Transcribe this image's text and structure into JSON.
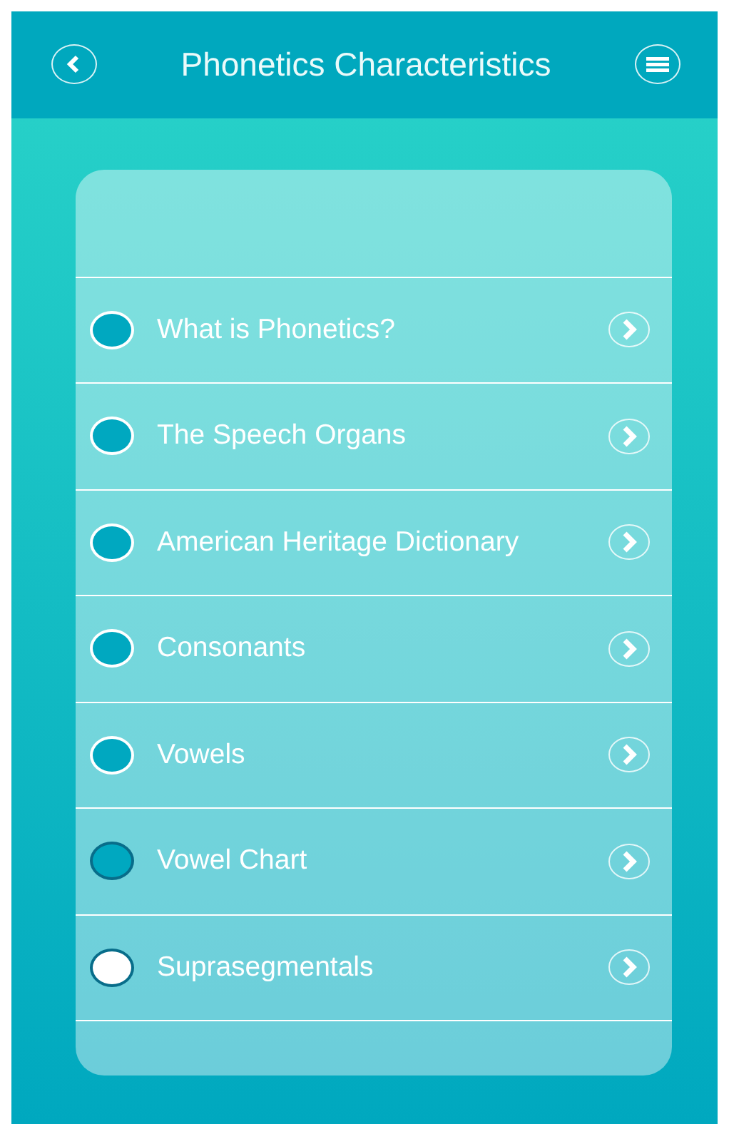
{
  "header": {
    "title": "Phonetics Characteristics"
  },
  "topics": [
    {
      "label": "What is Phonetics?",
      "color": "#00a8c0",
      "outlined": false
    },
    {
      "label": "The Speech Organs",
      "color": "#00a8c0",
      "outlined": false
    },
    {
      "label": "American Heritage Dictionary",
      "color": "#00a8c0",
      "outlined": false
    },
    {
      "label": "Consonants",
      "color": "#00a8c0",
      "outlined": false
    },
    {
      "label": "Vowels",
      "color": "#00a8c0",
      "outlined": false
    },
    {
      "label": "Vowel Chart",
      "color": "#00a8c0",
      "outlined": true
    },
    {
      "label": "Suprasegmentals",
      "color": "#ffffff",
      "outlined": true
    }
  ]
}
